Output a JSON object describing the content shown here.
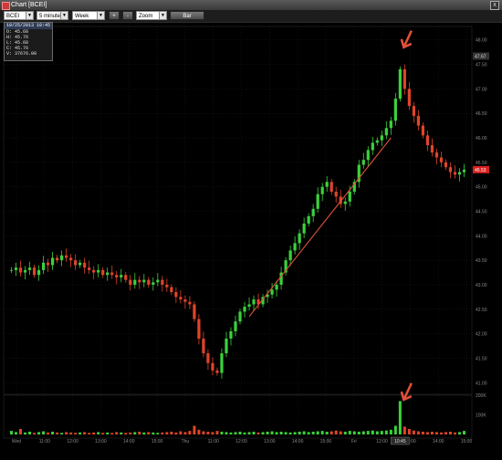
{
  "window": {
    "title": "Chart [BCEI]",
    "close_glyph": "x"
  },
  "toolbar": {
    "symbol": "BCEI",
    "interval": "5 minutes",
    "period": "Week",
    "zoom_in": "+",
    "zoom_out": "-",
    "zoom_mode": "Zoom",
    "chart_style": "Bar"
  },
  "info_box": {
    "header": "10/25/2013 10:45",
    "open": "O: 45.68",
    "high": "H: 45.76",
    "low": "L: 45.68",
    "close": "C: 45.76",
    "volume": "V: 37676.00"
  },
  "annotations": {
    "arrow_color": "#e0503a"
  },
  "chart_data": {
    "type": "candlestick",
    "price_axis_ticks": [
      48.0,
      47.5,
      47.0,
      46.5,
      46.0,
      45.5,
      45.0,
      44.5,
      44.0,
      43.5,
      43.0,
      42.5,
      42.0,
      41.5,
      41.0
    ],
    "price_axis_labels": [
      "48.00",
      "47.50",
      "47.00",
      "46.50",
      "46.00",
      "45.50",
      "45.00",
      "44.50",
      "44.00",
      "43.50",
      "43.00",
      "42.50",
      "42.00",
      "41.50",
      "41.00"
    ],
    "ylim": [
      40.8,
      48.2
    ],
    "last_price_label": "45.53",
    "hover_price_label": "47.67",
    "volume_axis_labels": [
      "200K",
      "100K"
    ],
    "volume_ylim": [
      0,
      200000
    ],
    "x_labels": [
      "Wed",
      "11:00",
      "12:00",
      "13:00",
      "14:00",
      "15:00",
      "Thu",
      "11:00",
      "12:00",
      "13:00",
      "14:00",
      "15:00",
      "Fri",
      "12:00",
      "13:00",
      "14:00",
      "15:00"
    ],
    "crosshair_x_label": "10:45",
    "grid": true,
    "up_color": "#3bd23b",
    "down_color": "#e0442a",
    "trendline_color": "#e0503a",
    "close_path": [
      43.3,
      43.35,
      43.25,
      43.3,
      43.35,
      43.2,
      43.3,
      43.45,
      43.4,
      43.55,
      43.5,
      43.6,
      43.55,
      43.5,
      43.4,
      43.45,
      43.35,
      43.3,
      43.25,
      43.3,
      43.2,
      43.25,
      43.2,
      43.15,
      43.2,
      43.1,
      43.0,
      43.1,
      43.05,
      43.1,
      43.0,
      43.05,
      43.1,
      43.0,
      42.95,
      42.85,
      42.75,
      42.7,
      42.65,
      42.6,
      42.3,
      41.9,
      41.6,
      41.4,
      41.25,
      41.2,
      41.6,
      41.9,
      42.05,
      42.25,
      42.45,
      42.55,
      42.6,
      42.7,
      42.6,
      42.75,
      42.8,
      42.9,
      43.0,
      43.25,
      43.5,
      43.7,
      43.85,
      44.05,
      44.25,
      44.4,
      44.55,
      44.85,
      45.0,
      45.1,
      44.9,
      44.8,
      44.65,
      44.7,
      44.9,
      45.1,
      45.45,
      45.55,
      45.75,
      45.9,
      45.95,
      46.05,
      46.2,
      46.35,
      46.8,
      47.4,
      47.0,
      46.65,
      46.45,
      46.25,
      46.05,
      45.85,
      45.7,
      45.6,
      45.5,
      45.4,
      45.3,
      45.25,
      45.3,
      45.35
    ],
    "volume": [
      9,
      6,
      14,
      5,
      7,
      4,
      6,
      8,
      5,
      7,
      5,
      4,
      6,
      5,
      4,
      5,
      6,
      4,
      5,
      6,
      4,
      5,
      4,
      6,
      5,
      4,
      5,
      6,
      7,
      5,
      6,
      5,
      4,
      5,
      6,
      7,
      5,
      8,
      6,
      9,
      22,
      12,
      8,
      7,
      6,
      9,
      7,
      6,
      5,
      6,
      7,
      5,
      6,
      7,
      5,
      6,
      7,
      8,
      6,
      7,
      6,
      5,
      6,
      7,
      8,
      6,
      7,
      8,
      9,
      7,
      8,
      10,
      8,
      7,
      9,
      8,
      7,
      8,
      9,
      10,
      8,
      9,
      10,
      12,
      22,
      85,
      20,
      14,
      10,
      8,
      7,
      6,
      7,
      6,
      5,
      6,
      7,
      5,
      6,
      9
    ]
  }
}
